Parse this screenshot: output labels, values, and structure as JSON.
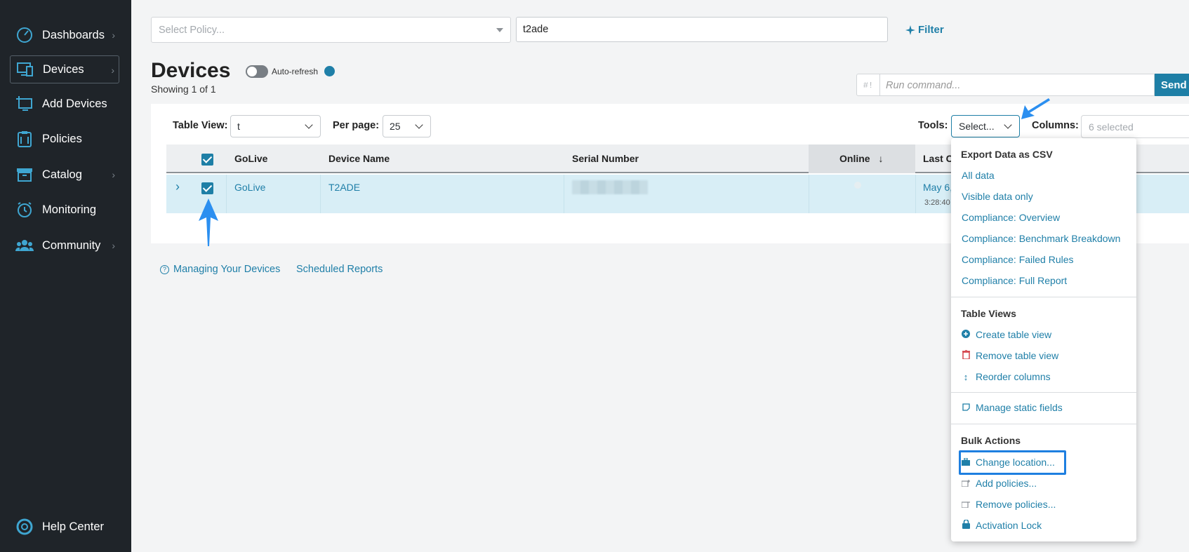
{
  "sidebar": {
    "items": [
      {
        "label": "Dashboards",
        "icon": "dashboard-gauge-icon",
        "chevron": true
      },
      {
        "label": "Devices",
        "icon": "devices-monitor-icon",
        "chevron": true,
        "active": true
      },
      {
        "label": "Add Devices",
        "icon": "add-device-icon",
        "chevron": false
      },
      {
        "label": "Policies",
        "icon": "policies-clipboard-icon",
        "chevron": false
      },
      {
        "label": "Catalog",
        "icon": "catalog-box-icon",
        "chevron": true
      },
      {
        "label": "Monitoring",
        "icon": "monitoring-clock-icon",
        "chevron": false
      },
      {
        "label": "Community",
        "icon": "community-users-icon",
        "chevron": true
      }
    ],
    "help": {
      "label": "Help Center",
      "icon": "lifebuoy-icon"
    }
  },
  "topbar": {
    "policy_placeholder": "Select Policy...",
    "search_value": "t2ade",
    "filter_label": "Filter"
  },
  "page": {
    "title": "Devices",
    "showing": "Showing 1 of 1",
    "autorefresh_label": "Auto-refresh",
    "command_prefix": "#!",
    "command_placeholder": "Run command...",
    "send_label": "Send"
  },
  "toolbar": {
    "table_view_label": "Table View:",
    "table_view_value": "t",
    "per_page_label": "Per page:",
    "per_page_value": "25",
    "tools_label": "Tools:",
    "tools_value": "Select...",
    "columns_label": "Columns:",
    "columns_value": "6 selected"
  },
  "table": {
    "headers": [
      "GoLive",
      "Device Name",
      "Serial Number",
      "Online",
      "Last C"
    ],
    "online_sort": "↓",
    "rows": [
      {
        "golive": "GoLive",
        "device_name": "T2ADE",
        "last_checkin_date": "May 6,",
        "last_checkin_time": "3:28:40"
      }
    ]
  },
  "links": {
    "managing": "Managing Your Devices",
    "scheduled": "Scheduled Reports"
  },
  "menu": {
    "export_heading": "Export Data as CSV",
    "export_items": [
      "All data",
      "Visible data only",
      "Compliance: Overview",
      "Compliance: Benchmark Breakdown",
      "Compliance: Failed Rules",
      "Compliance: Full Report"
    ],
    "views_heading": "Table Views",
    "view_items": [
      {
        "label": "Create table view",
        "icon": "plus-circle-icon"
      },
      {
        "label": "Remove table view",
        "icon": "trash-icon"
      },
      {
        "label": "Reorder columns",
        "icon": "up-down-arrow-icon"
      }
    ],
    "static_item": {
      "label": "Manage static fields",
      "icon": "note-icon"
    },
    "bulk_heading": "Bulk Actions",
    "bulk_items": [
      {
        "label": "Change location...",
        "icon": "location-briefcase-icon"
      },
      {
        "label": "Add policies...",
        "icon": "add-policy-icon"
      },
      {
        "label": "Remove policies...",
        "icon": "remove-policy-icon"
      },
      {
        "label": "Activation Lock",
        "icon": "lock-icon"
      }
    ]
  },
  "colors": {
    "accent": "#1e7fa6",
    "sidebar_bg": "#1f2429",
    "row_selected": "#d8eef6",
    "highlight": "#1e7fe0",
    "arrow": "#2b8ff0"
  }
}
